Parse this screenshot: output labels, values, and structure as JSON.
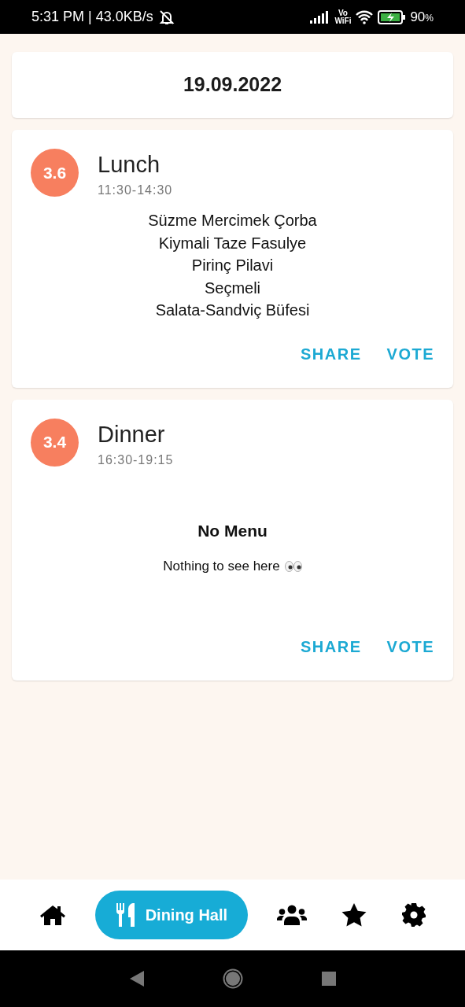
{
  "status_bar": {
    "time": "5:31 PM | 43.0KB/s",
    "volte_top": "Vo",
    "volte_bottom": "WiFi",
    "battery": "90",
    "battery_unit": "%"
  },
  "date": "19.09.2022",
  "meals": [
    {
      "kind": "menu",
      "rating": "3.6",
      "title": "Lunch",
      "hours": "11:30-14:30",
      "items": [
        "Süzme Mercimek Çorba",
        "Kiymali Taze Fasulye",
        "Pirinç Pilavi",
        "Seçmeli",
        "Salata-Sandviç Büfesi"
      ],
      "actions": [
        "SHARE",
        "VOTE"
      ]
    },
    {
      "kind": "empty",
      "rating": "3.4",
      "title": "Dinner",
      "hours": "16:30-19:15",
      "empty_title": "No Menu",
      "empty_text": "Nothing to see here",
      "actions": [
        "SHARE",
        "VOTE"
      ]
    }
  ],
  "nav": [
    {
      "kind": "home",
      "selected": false
    },
    {
      "kind": "dining",
      "label": "Dining Hall",
      "selected": true
    },
    {
      "kind": "people",
      "selected": false
    },
    {
      "kind": "star",
      "selected": false
    },
    {
      "kind": "settings",
      "selected": false
    }
  ]
}
